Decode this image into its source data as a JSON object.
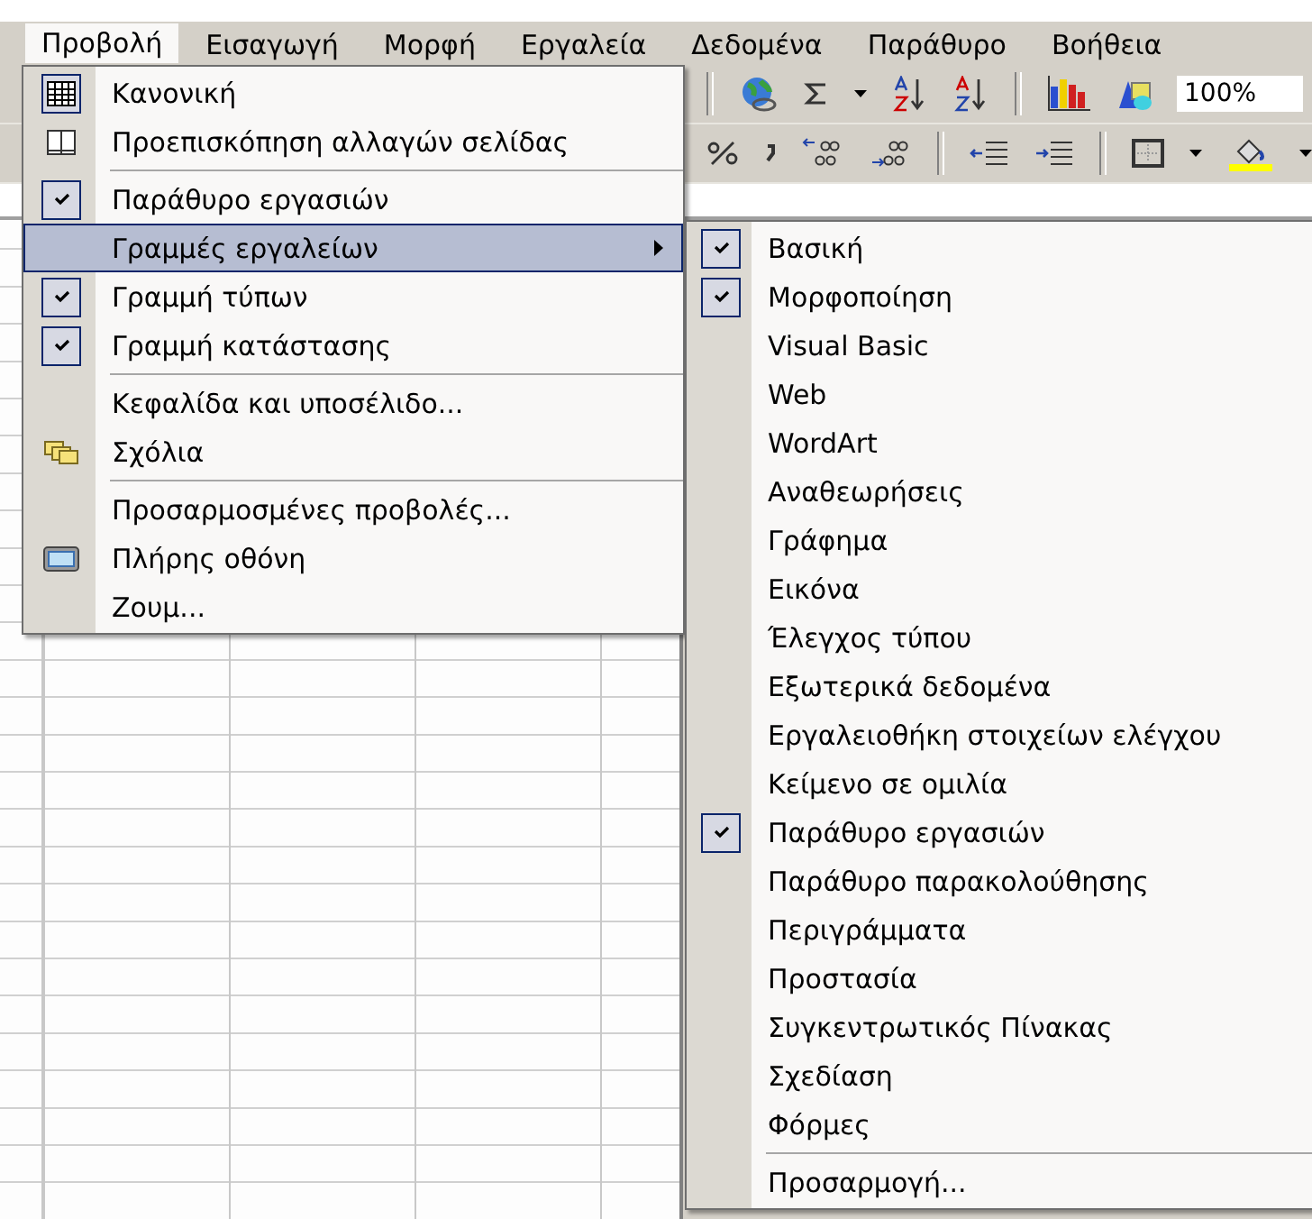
{
  "menubar": [
    {
      "label": "Προβολή",
      "selected": true
    },
    {
      "label": "Εισαγωγή",
      "selected": false
    },
    {
      "label": "Μορφή",
      "selected": false
    },
    {
      "label": "Εργαλεία",
      "selected": false
    },
    {
      "label": "Δεδομένα",
      "selected": false
    },
    {
      "label": "Παράθυρο",
      "selected": false
    },
    {
      "label": "Βοήθεια",
      "selected": false
    }
  ],
  "toolbar": {
    "zoom": "100%"
  },
  "view_menu": {
    "items": [
      {
        "kind": "table",
        "label": "Κανονική",
        "checked": true,
        "selected": false
      },
      {
        "kind": "pages",
        "label": "Προεπισκόπηση αλλαγών σελίδας",
        "checked": false,
        "selected": false
      },
      {
        "kind": "separator"
      },
      {
        "kind": "plain",
        "label": "Παράθυρο εργασιών",
        "checked": true,
        "selected": false
      },
      {
        "kind": "submenu",
        "label": "Γραμμές εργαλείων",
        "checked": false,
        "selected": true
      },
      {
        "kind": "plain",
        "label": "Γραμμή τύπων",
        "checked": true,
        "selected": false
      },
      {
        "kind": "plain",
        "label": "Γραμμή κατάστασης",
        "checked": true,
        "selected": false
      },
      {
        "kind": "separator"
      },
      {
        "kind": "plain",
        "label": "Κεφαλίδα και υποσέλιδο...",
        "checked": false,
        "selected": false
      },
      {
        "kind": "notes",
        "label": "Σχόλια",
        "checked": false,
        "selected": false
      },
      {
        "kind": "separator"
      },
      {
        "kind": "plain",
        "label": "Προσαρμοσμένες προβολές...",
        "checked": false,
        "selected": false
      },
      {
        "kind": "screen",
        "label": "Πλήρης οθόνη",
        "checked": false,
        "selected": false
      },
      {
        "kind": "plain",
        "label": "Ζουμ...",
        "checked": false,
        "selected": false
      }
    ]
  },
  "toolbars_submenu": {
    "items": [
      {
        "kind": "plain",
        "label": "Βασική",
        "checked": true
      },
      {
        "kind": "plain",
        "label": "Μορφοποίηση",
        "checked": true
      },
      {
        "kind": "plain",
        "label": "Visual Basic",
        "checked": false
      },
      {
        "kind": "plain",
        "label": "Web",
        "checked": false
      },
      {
        "kind": "plain",
        "label": "WordArt",
        "checked": false
      },
      {
        "kind": "plain",
        "label": "Αναθεωρήσεις",
        "checked": false
      },
      {
        "kind": "plain",
        "label": "Γράφημα",
        "checked": false
      },
      {
        "kind": "plain",
        "label": "Εικόνα",
        "checked": false
      },
      {
        "kind": "plain",
        "label": "Έλεγχος τύπου",
        "checked": false
      },
      {
        "kind": "plain",
        "label": "Εξωτερικά δεδομένα",
        "checked": false
      },
      {
        "kind": "plain",
        "label": "Εργαλειοθήκη στοιχείων ελέγχου",
        "checked": false
      },
      {
        "kind": "plain",
        "label": "Κείμενο σε ομιλία",
        "checked": false
      },
      {
        "kind": "plain",
        "label": "Παράθυρο εργασιών",
        "checked": true
      },
      {
        "kind": "plain",
        "label": "Παράθυρο παρακολούθησης",
        "checked": false
      },
      {
        "kind": "plain",
        "label": "Περιγράμματα",
        "checked": false
      },
      {
        "kind": "plain",
        "label": "Προστασία",
        "checked": false
      },
      {
        "kind": "plain",
        "label": "Συγκεντρωτικός Πίνακας",
        "checked": false
      },
      {
        "kind": "plain",
        "label": "Σχεδίαση",
        "checked": false
      },
      {
        "kind": "plain",
        "label": "Φόρμες",
        "checked": false
      },
      {
        "kind": "separator"
      },
      {
        "kind": "plain",
        "label": "Προσαρμογή...",
        "checked": false
      }
    ]
  }
}
